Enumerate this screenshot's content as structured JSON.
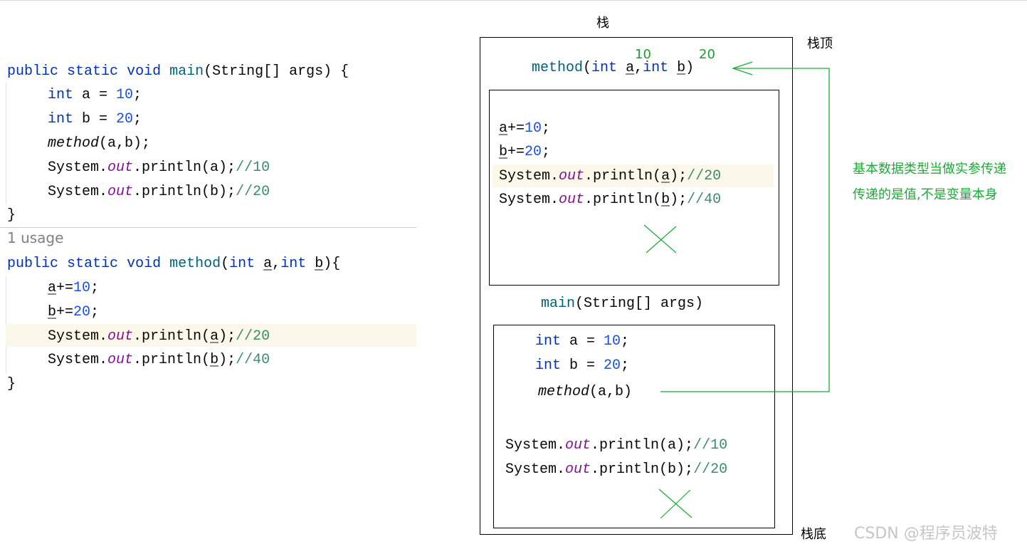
{
  "code": {
    "main": {
      "kw_public": "public",
      "kw_static": "static",
      "kw_void": "void",
      "name": "main",
      "params": "(String[] args) {",
      "int_kw": "int",
      "stmt_a_var": " a = ",
      "stmt_a_val": "10",
      "stmt_b_var": " b = ",
      "stmt_b_val": "20",
      "semi": ";",
      "call_name": "method",
      "call_args": "(a,b);",
      "sys": "System.",
      "out": "out",
      "println_a": ".println(a);",
      "cmt_a": "//10",
      "println_b": ".println(b);",
      "cmt_b": "//20",
      "close": "}"
    },
    "usage": "1 usage",
    "method": {
      "kw_public": "public",
      "kw_static": "static",
      "kw_void": "void",
      "name": "method",
      "open_paren": "(",
      "int_kw": "int",
      "param_a": "a",
      "comma": ",",
      "param_b": "b",
      "close_sig": "){",
      "a_plus": "+=",
      "a_val": "10",
      "b_plus": "+=",
      "b_val": "20",
      "semi": ";",
      "sys": "System.",
      "out": "out",
      "println_pre": ".println(",
      "println_post": ");",
      "var_a": "a",
      "var_b": "b",
      "cmt_a": "//20",
      "cmt_b": "//40",
      "close": "}"
    }
  },
  "diagram": {
    "stack_label": "栈",
    "stack_top_label": "栈顶",
    "stack_bottom_label": "栈底",
    "top_values": [
      "10",
      "20"
    ],
    "method_sig": {
      "name": "method",
      "open": "(",
      "int_kw": "int",
      "a": "a",
      "comma": ",",
      "b": "b",
      "close": ")"
    },
    "method_frame": {
      "a": "a",
      "b": "b",
      "plus_eq": "+=",
      "v10": "10",
      "v20": "20",
      "semi": ";",
      "sys": "System.",
      "out": "out",
      "println_pre": ".println(",
      "println_post": ");",
      "cmt_a": "//20",
      "cmt_b": "//40"
    },
    "main_sig": {
      "name": "main",
      "rest": "(String[] args)"
    },
    "main_frame": {
      "int_kw": "int",
      "a_decl": " a = ",
      "b_decl": " b = ",
      "v10": "10",
      "v20": "20",
      "semi": ";",
      "call_name": "method",
      "call_args": "(a,b)",
      "sys": "System.",
      "out": "out",
      "println_a": ".println(a);",
      "println_b": ".println(b);",
      "cmt_a": "//10",
      "cmt_b": "//20"
    },
    "note_lines": [
      "基本数据类型当做实参传递",
      "传递的是值,不是变量本身"
    ],
    "colors": {
      "arrow_green": "#1bab36",
      "keyword_blue": "#0033b3",
      "field_purple": "#871094"
    }
  },
  "watermark": "CSDN @程序员波特"
}
